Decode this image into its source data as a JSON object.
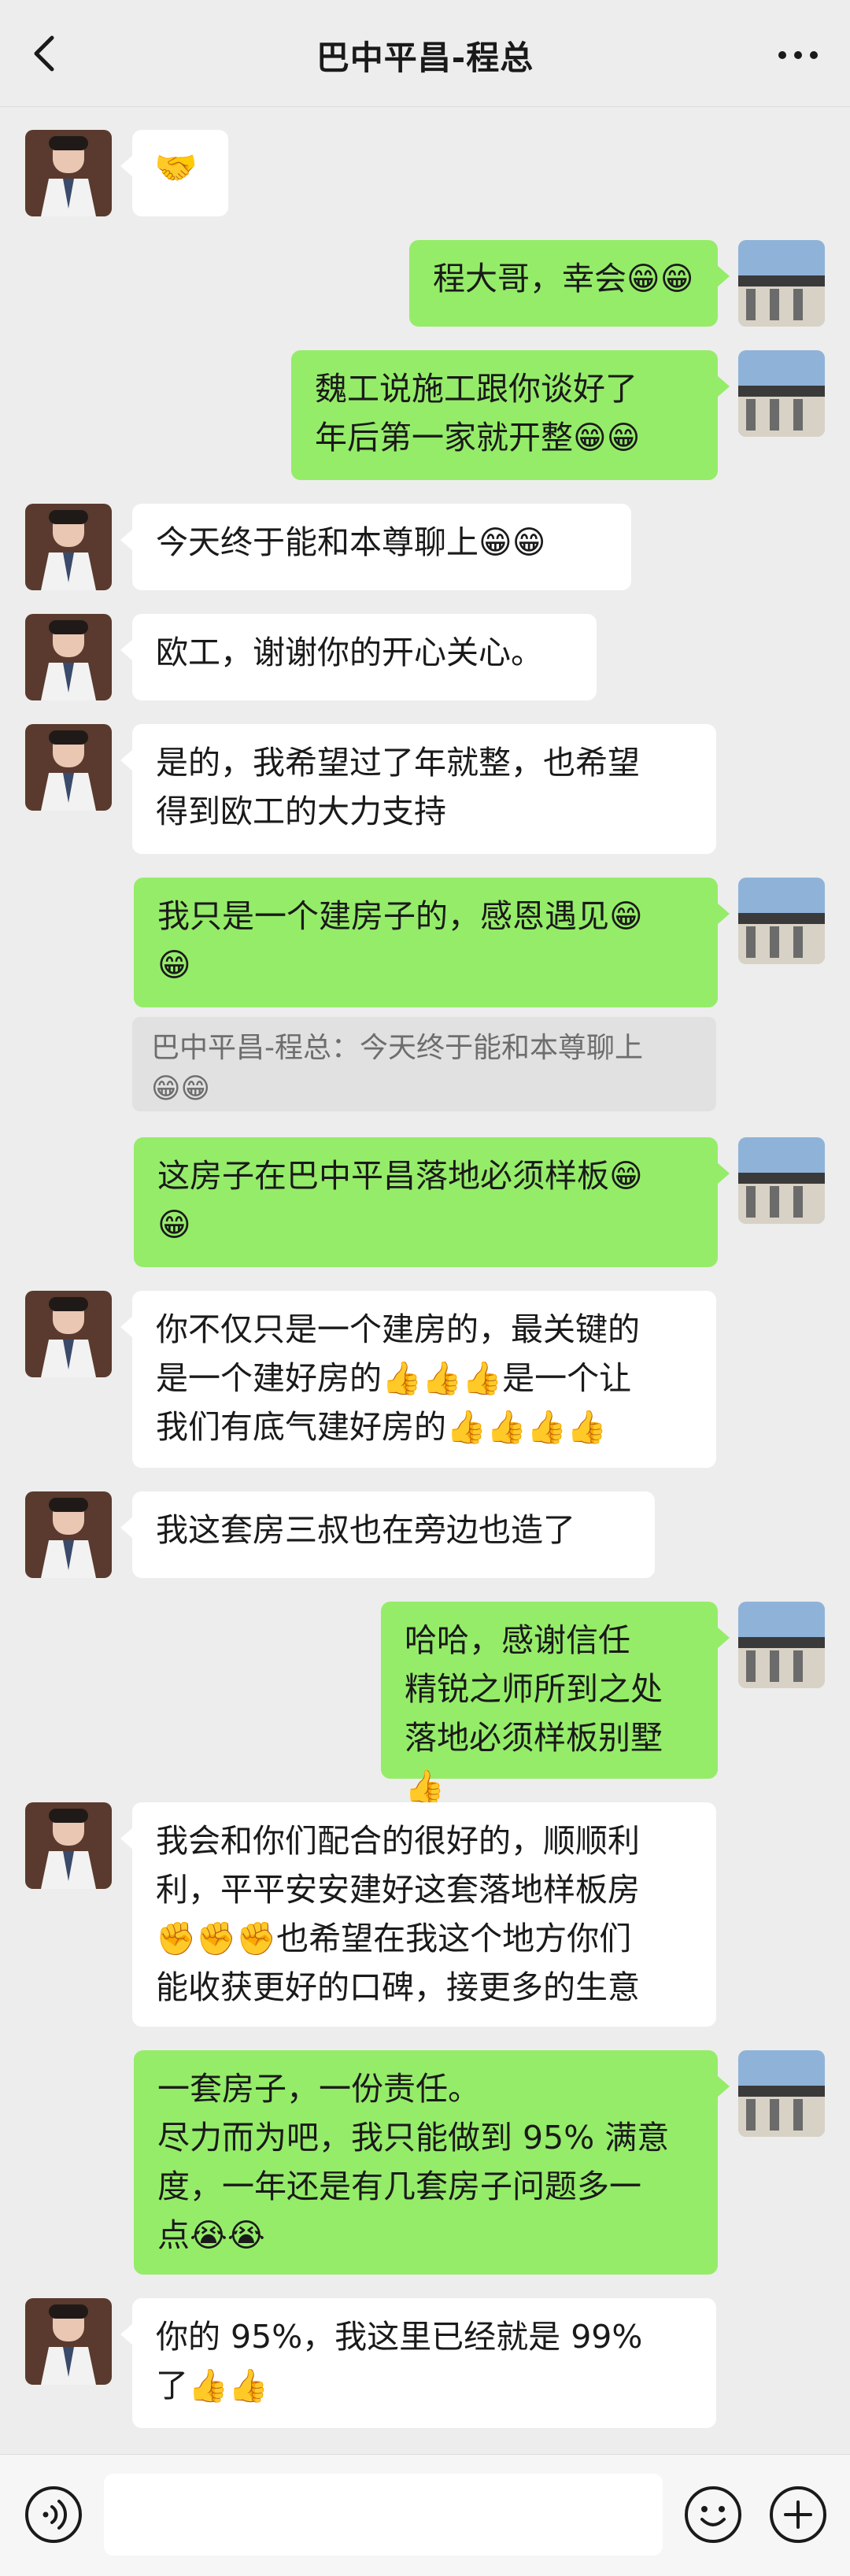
{
  "header": {
    "title": "巴中平昌-程总"
  },
  "icons": {
    "back": "chevron-left-icon",
    "more": "more-dots-icon",
    "voice": "voice-icon",
    "emoji": "emoji-icon",
    "plus": "plus-icon"
  },
  "colors": {
    "background": "#ededed",
    "bubble_sent": "#95ec69",
    "bubble_received": "#ffffff",
    "quote_bg": "#e1e1e1"
  },
  "messages": [
    {
      "side": "left",
      "text": "🤝"
    },
    {
      "side": "right",
      "text": "程大哥，幸会😁😁"
    },
    {
      "side": "right",
      "text": "魏工说施工跟你谈好了\n年后第一家就开整😁😁"
    },
    {
      "side": "left",
      "text": "今天终于能和本尊聊上😁😁"
    },
    {
      "side": "left",
      "text": "欧工，谢谢你的开心关心。"
    },
    {
      "side": "left",
      "text": "是的，我希望过了年就整，也希望\n得到欧工的大力支持"
    },
    {
      "side": "right",
      "text": "我只是一个建房子的，感恩遇见😁\n😁"
    },
    {
      "side": "quote",
      "text": "巴中平昌-程总：今天终于能和本尊聊上\n😁😁"
    },
    {
      "side": "right",
      "text": "这房子在巴中平昌落地必须样板😁\n😁"
    },
    {
      "side": "left",
      "text": "你不仅只是一个建房的，最关键的\n是一个建好房的👍👍👍是一个让\n我们有底气建好房的👍👍👍👍"
    },
    {
      "side": "left",
      "text": "我这套房三叔也在旁边也造了"
    },
    {
      "side": "right",
      "text": "哈哈，感谢信任\n精锐之师所到之处\n落地必须样板别墅👍"
    },
    {
      "side": "left",
      "text": "我会和你们配合的很好的，顺顺利\n利，平平安安建好这套落地样板房\n✊✊✊也希望在我这个地方你们\n能收获更好的口碑，接更多的生意"
    },
    {
      "side": "right",
      "text": "一套房子，一份责任。\n尽力而为吧，我只能做到 95% 满意\n度，一年还是有几套房子问题多一\n点😭😭"
    },
    {
      "side": "left",
      "text": "你的 95%，我这里已经就是 99%\n了👍👍"
    }
  ]
}
